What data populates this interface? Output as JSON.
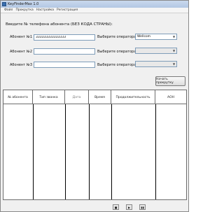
{
  "window": {
    "title": "KeyFinderMax 1.0"
  },
  "menu": [
    "Файл",
    "Прокрутка",
    "Настройка",
    "Регистрация"
  ],
  "instruction": "Введите № телефона абонента (БЕЗ КОДА СТРАНЫ):",
  "subscribers": [
    {
      "label": "Абонент №1",
      "phone": "333333333333333",
      "operator_label": "Выберите оператора:",
      "operator": "Wellcom",
      "enabled": true
    },
    {
      "label": "Абонент №2",
      "phone": "",
      "operator_label": "Выберите оператора:",
      "operator": "",
      "enabled": false
    },
    {
      "label": "Абонент №3",
      "phone": "",
      "operator_label": "Выберите оператора:",
      "operator": "",
      "enabled": false
    }
  ],
  "start_button": "Начать прокрутку",
  "table": {
    "columns": [
      "№ абонента",
      "Тип звонка",
      "Дата",
      "Время",
      "Продолжительность",
      "АОН"
    ]
  },
  "nav_icons": [
    "stop-icon",
    "play-icon",
    "pause-icon"
  ]
}
